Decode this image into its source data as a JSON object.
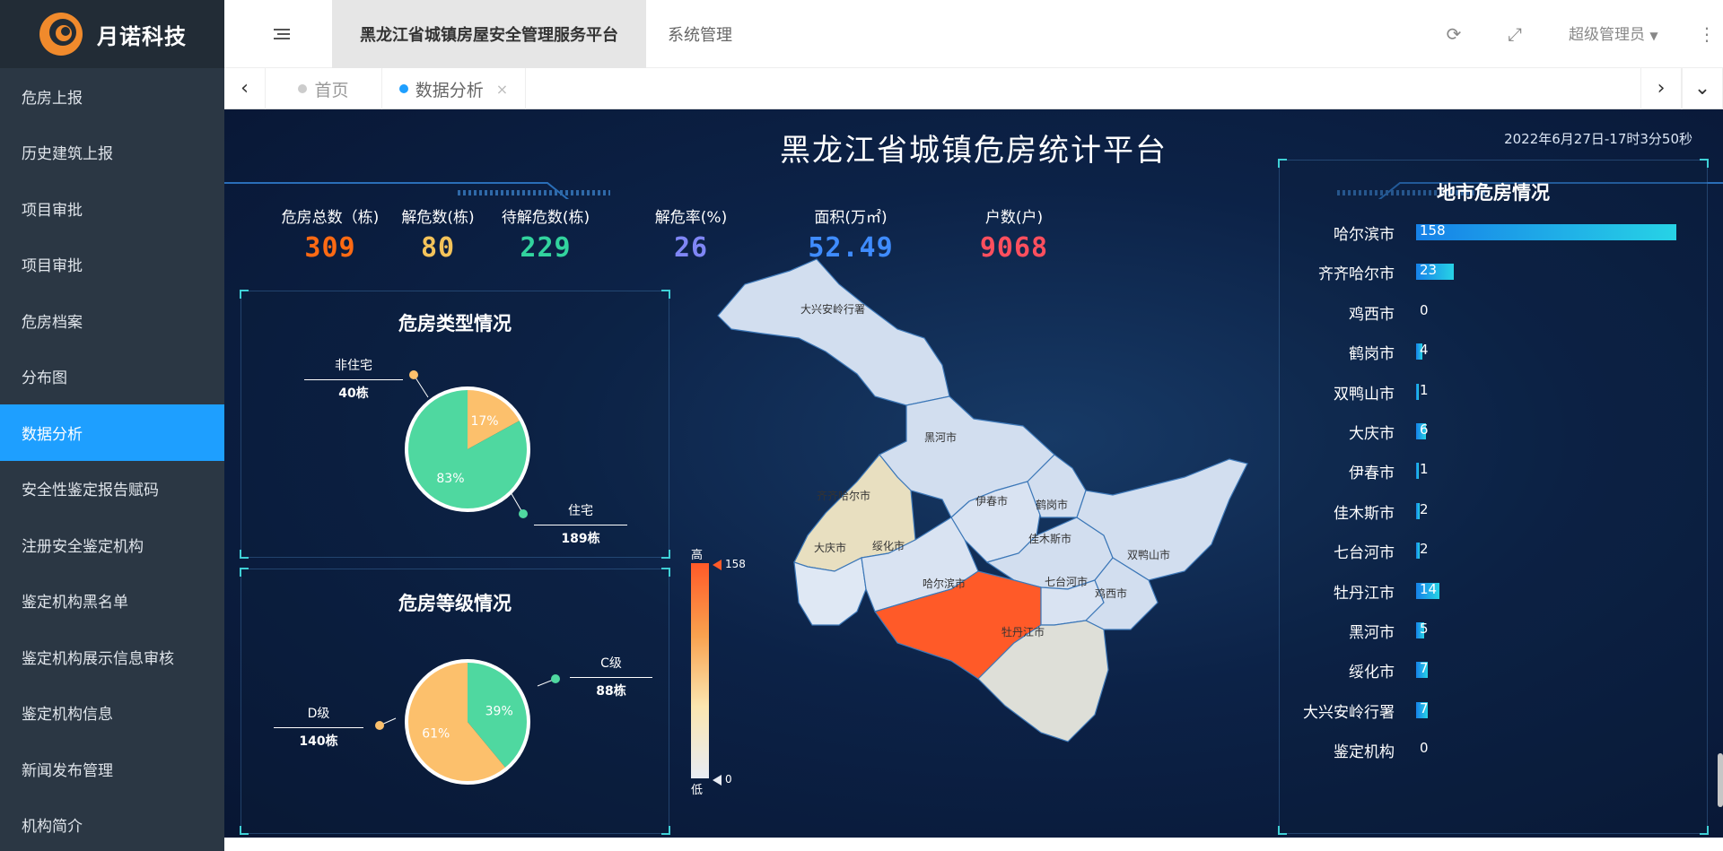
{
  "brand": {
    "name": "月诺科技"
  },
  "sidebar": {
    "items": [
      {
        "label": "危房上报"
      },
      {
        "label": "历史建筑上报"
      },
      {
        "label": "项目审批"
      },
      {
        "label": "项目审批"
      },
      {
        "label": "危房档案"
      },
      {
        "label": "分布图"
      },
      {
        "label": "数据分析",
        "active": true
      },
      {
        "label": "安全性鉴定报告赋码"
      },
      {
        "label": "注册安全鉴定机构"
      },
      {
        "label": "鉴定机构黑名单"
      },
      {
        "label": "鉴定机构展示信息审核"
      },
      {
        "label": "鉴定机构信息"
      },
      {
        "label": "新闻发布管理"
      },
      {
        "label": "机构简介"
      }
    ]
  },
  "header": {
    "tabs": [
      {
        "label": "黑龙江省城镇房屋安全管理服务平台"
      },
      {
        "label": "系统管理"
      }
    ],
    "user": "超级管理员",
    "icons": [
      "menu-icon",
      "refresh-icon",
      "fullscreen-icon",
      "more-icon"
    ]
  },
  "page_tabs": [
    {
      "label": "首页"
    },
    {
      "label": "数据分析",
      "active": true,
      "close": "×"
    }
  ],
  "dashboard": {
    "title": "黑龙江省城镇危房统计平台",
    "time": "2022年6月27日-17时3分50秒",
    "stats": [
      {
        "label": "危房总数（栋)",
        "value": "309",
        "color": "#ff6a13"
      },
      {
        "label": "解危数(栋)",
        "value": "80",
        "color": "#f4c35a"
      },
      {
        "label": "待解危数(栋)",
        "value": "229",
        "color": "#32d39e"
      },
      {
        "label": "解危率(%)",
        "value": "26",
        "color": "#7f86f5"
      },
      {
        "label": "面积(万㎡)",
        "value": "52.49",
        "color": "#3f8cff"
      },
      {
        "label": "户数(户)",
        "value": "9068",
        "color": "#ff4f5e"
      }
    ],
    "type_panel": {
      "title": "危房类型情况",
      "slices": [
        {
          "name": "非住宅",
          "count": "40栋",
          "percent": "17%",
          "value": 17,
          "color": "#fcc06c"
        },
        {
          "name": "住宅",
          "count": "189栋",
          "percent": "83%",
          "value": 83,
          "color": "#4fd8a0"
        }
      ]
    },
    "level_panel": {
      "title": "危房等级情况",
      "slices": [
        {
          "name": "C级",
          "count": "88栋",
          "percent": "39%",
          "value": 39,
          "color": "#4fd8a0"
        },
        {
          "name": "D级",
          "count": "140栋",
          "percent": "61%",
          "value": 61,
          "color": "#fcc06c"
        }
      ]
    },
    "map": {
      "legend_high": "高",
      "legend_low": "低",
      "legend_max": "158",
      "legend_min": "0",
      "regions": [
        "大兴安岭行署",
        "黑河市",
        "齐齐哈尔市",
        "伊春市",
        "鹤岗市",
        "大庆市",
        "绥化市",
        "佳木斯市",
        "双鸭山市",
        "哈尔滨市",
        "七台河市",
        "鸡西市",
        "牡丹江市"
      ]
    },
    "city_panel": {
      "title": "地市危房情况",
      "max": 158,
      "cities": [
        {
          "name": "哈尔滨市",
          "value": 158
        },
        {
          "name": "齐齐哈尔市",
          "value": 23
        },
        {
          "name": "鸡西市",
          "value": 0
        },
        {
          "name": "鹤岗市",
          "value": 4
        },
        {
          "name": "双鸭山市",
          "value": 1
        },
        {
          "name": "大庆市",
          "value": 6
        },
        {
          "name": "伊春市",
          "value": 1
        },
        {
          "name": "佳木斯市",
          "value": 2
        },
        {
          "name": "七台河市",
          "value": 2
        },
        {
          "name": "牡丹江市",
          "value": 14
        },
        {
          "name": "黑河市",
          "value": 5
        },
        {
          "name": "绥化市",
          "value": 7
        },
        {
          "name": "大兴安岭行署",
          "value": 7
        },
        {
          "name": "鉴定机构",
          "value": 0
        }
      ]
    }
  }
}
